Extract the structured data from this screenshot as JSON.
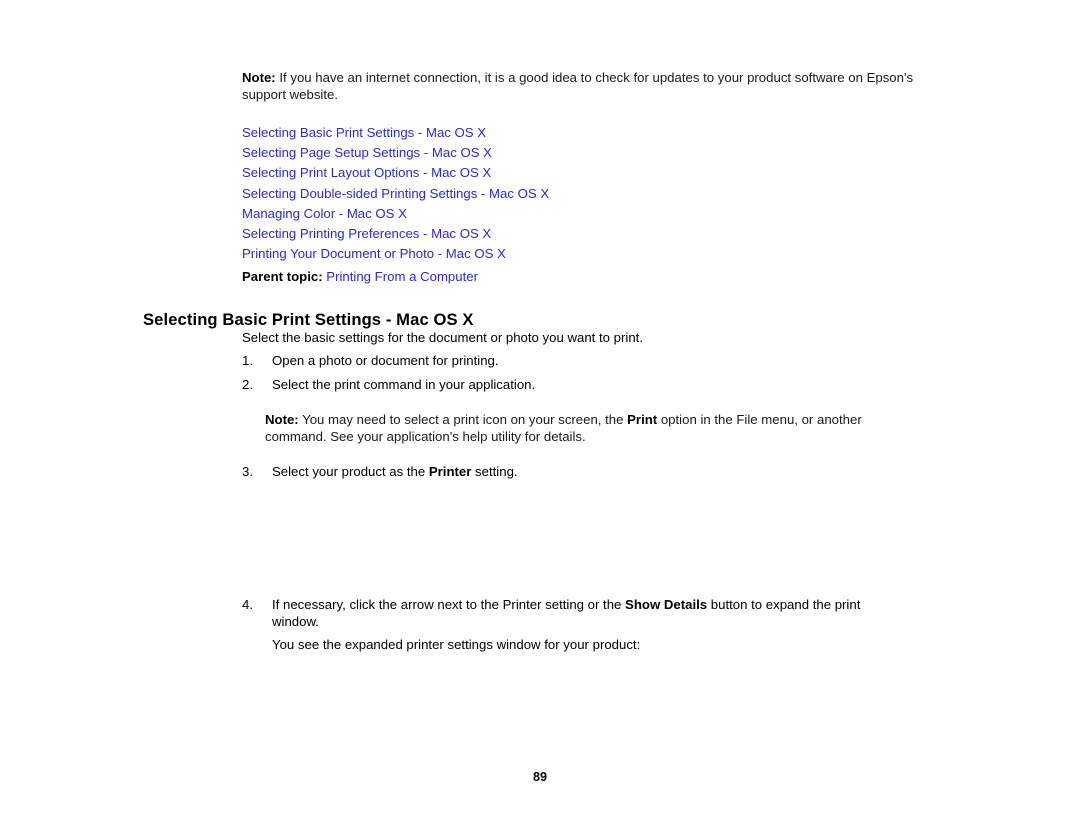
{
  "document": {
    "page_number": "89",
    "link_color": "#2a2ad6",
    "text_color": "#1a1a1a"
  },
  "note_top": {
    "label": "Note:",
    "text": " If you have an internet connection, it is a good idea to check for updates to your product software on Epson's support website."
  },
  "topic_links": [
    {
      "label": "Selecting Basic Print Settings - Mac OS X"
    },
    {
      "label": "Selecting Page Setup Settings - Mac OS X"
    },
    {
      "label": "Selecting Print Layout Options - Mac OS X"
    },
    {
      "label": "Selecting Double-sided Printing Settings - Mac OS X"
    },
    {
      "label": "Managing Color - Mac OS X"
    },
    {
      "label": "Selecting Printing Preferences - Mac OS X"
    },
    {
      "label": "Printing Your Document or Photo - Mac OS X"
    }
  ],
  "parent_topic": {
    "label": "Parent topic:",
    "link": "Printing From a Computer"
  },
  "section": {
    "heading": "Selecting Basic Print Settings - Mac OS X",
    "intro": "Select the basic settings for the document or photo you want to print."
  },
  "steps": [
    {
      "num": "1.",
      "text": "Open a photo or document for printing."
    },
    {
      "num": "2.",
      "text": "Select the print command in your application."
    },
    {
      "num": "3.",
      "prefix": "Select your product as the ",
      "bold": "Printer",
      "suffix": " setting."
    },
    {
      "num": "4.",
      "prefix": "If necessary, click the arrow next to the Printer setting or the ",
      "bold": "Show Details",
      "suffix": " button to expand the print window."
    }
  ],
  "note_middle": {
    "label": "Note:",
    "prefix": " You may need to select a print icon on your screen, the ",
    "bold": "Print",
    "suffix": " option in the File menu, or another command. See your application's help utility for details."
  },
  "follow_line": {
    "text": "You see the expanded printer settings window for your product:"
  }
}
